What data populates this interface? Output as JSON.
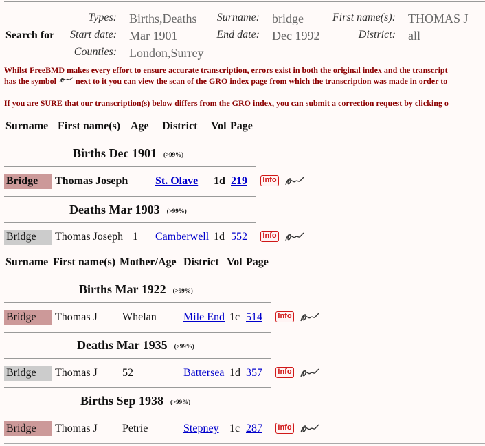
{
  "search": {
    "search_for": "Search for",
    "labels": {
      "types": "Types:",
      "surname": "Surname:",
      "first_names": "First name(s):",
      "start_date": "Start date:",
      "end_date": "End date:",
      "district": "District:",
      "counties": "Counties:"
    },
    "values": {
      "types": "Births,Deaths",
      "surname": "bridge",
      "first_names": "THOMAS J",
      "start_date": "Mar 1901",
      "end_date": "Dec 1992",
      "district": "all",
      "counties": "London,Surrey"
    }
  },
  "notice": {
    "line1": "Whilst FreeBMD makes every effort to ensure accurate transcription, errors exist in both the original index and the transcript",
    "line2_a": "has the symbol",
    "line2_b": "next to it you can view the scan of the GRO index page from which the transcription was made in order to",
    "line3": "If you are SURE that our transcription(s) below differs from the GRO index, you can submit a correction request by clicking o"
  },
  "table1": {
    "headers": [
      "Surname",
      "First name(s)",
      "Age",
      "District",
      "Vol",
      "Page"
    ]
  },
  "table2": {
    "headers": [
      "Surname",
      "First name(s)",
      "Mother/Age",
      "District",
      "Vol",
      "Page"
    ]
  },
  "groups": [
    {
      "title": "Births Dec 1901",
      "confidence": "(>99%)",
      "entry": {
        "surname": "Bridge",
        "first": "Thomas Joseph",
        "age": "",
        "district": "St. Olave",
        "vol": "1d",
        "page": "219"
      }
    },
    {
      "title": "Deaths Mar 1903",
      "confidence": "(>99%)",
      "entry": {
        "surname": "Bridge",
        "first": "Thomas Joseph",
        "age": "1",
        "district": "Camberwell",
        "vol": "1d",
        "page": "552"
      }
    },
    {
      "title": "Births Mar 1922",
      "confidence": "(>99%)",
      "entry": {
        "surname": "Bridge",
        "first": "Thomas J",
        "age": "Whelan",
        "district": "Mile End",
        "vol": "1c",
        "page": "514"
      }
    },
    {
      "title": "Deaths Mar 1935",
      "confidence": "(>99%)",
      "entry": {
        "surname": "Bridge",
        "first": "Thomas J",
        "age": "52",
        "district": "Battersea",
        "vol": "1d",
        "page": "357"
      }
    },
    {
      "title": "Births Sep 1938",
      "confidence": "(>99%)",
      "entry": {
        "surname": "Bridge",
        "first": "Thomas J",
        "age": "Petrie",
        "district": "Stepney",
        "vol": "1c",
        "page": "287"
      }
    }
  ],
  "info_label": "Info",
  "colors": {
    "birth_surname_bg": "#cc9999",
    "death_surname_bg": "#cccccc",
    "notice_text": "#8b0000",
    "link": "#0000cc"
  }
}
